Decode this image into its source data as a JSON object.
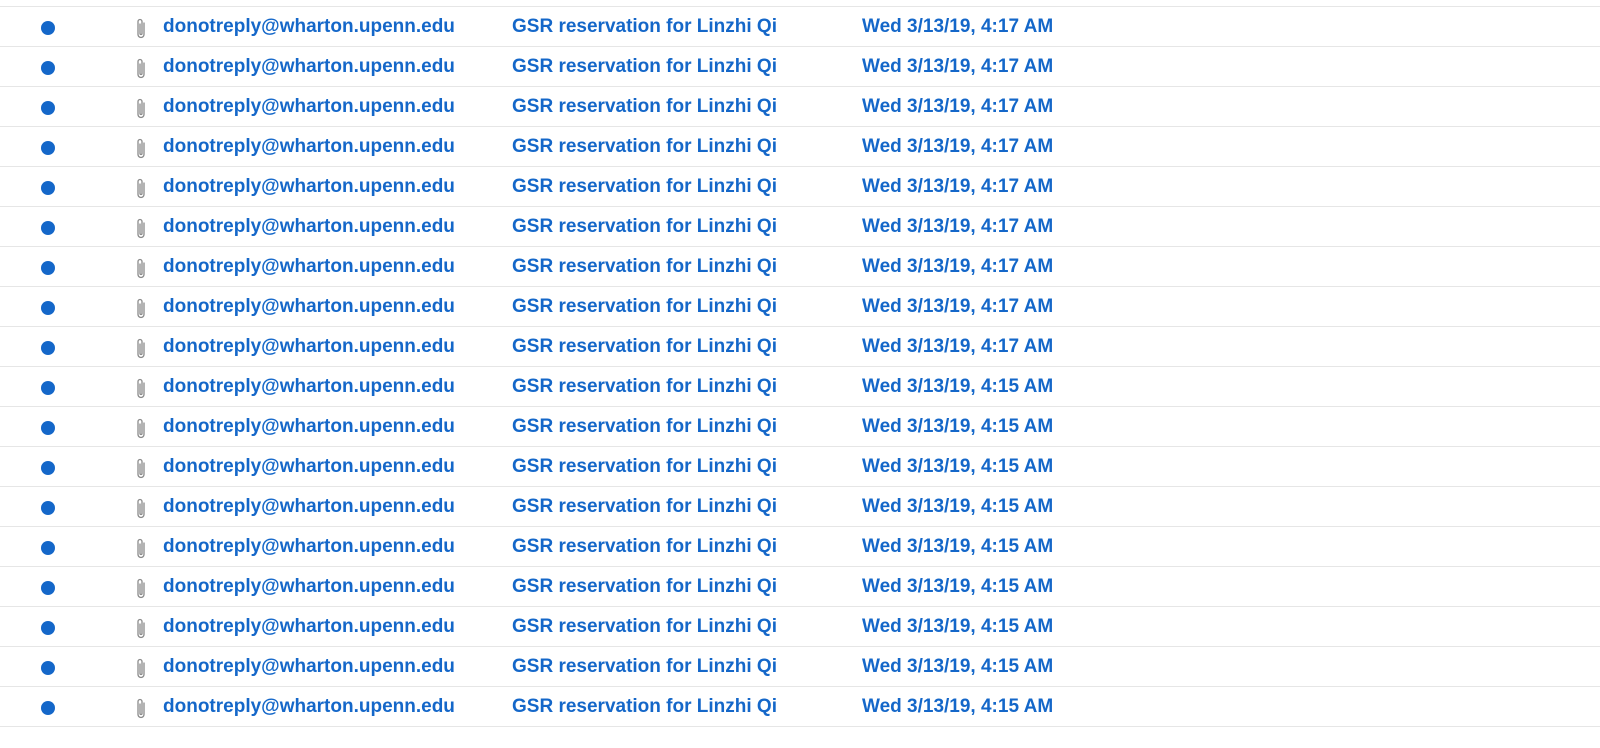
{
  "colors": {
    "unread_accent": "#1467c9",
    "row_divider": "#e6e6e6",
    "attachment_icon": "#8a8a8a"
  },
  "icons": {
    "unread": "unread-dot-icon",
    "attachment": "paperclip-icon"
  },
  "messages": [
    {
      "sender": "donotreply@wharton.upenn.edu",
      "subject": "GSR reservation for Linzhi Qi",
      "date": "Wed 3/13/19, 4:17 AM",
      "unread": true,
      "has_attachment": true
    },
    {
      "sender": "donotreply@wharton.upenn.edu",
      "subject": "GSR reservation for Linzhi Qi",
      "date": "Wed 3/13/19, 4:17 AM",
      "unread": true,
      "has_attachment": true
    },
    {
      "sender": "donotreply@wharton.upenn.edu",
      "subject": "GSR reservation for Linzhi Qi",
      "date": "Wed 3/13/19, 4:17 AM",
      "unread": true,
      "has_attachment": true
    },
    {
      "sender": "donotreply@wharton.upenn.edu",
      "subject": "GSR reservation for Linzhi Qi",
      "date": "Wed 3/13/19, 4:17 AM",
      "unread": true,
      "has_attachment": true
    },
    {
      "sender": "donotreply@wharton.upenn.edu",
      "subject": "GSR reservation for Linzhi Qi",
      "date": "Wed 3/13/19, 4:17 AM",
      "unread": true,
      "has_attachment": true
    },
    {
      "sender": "donotreply@wharton.upenn.edu",
      "subject": "GSR reservation for Linzhi Qi",
      "date": "Wed 3/13/19, 4:17 AM",
      "unread": true,
      "has_attachment": true
    },
    {
      "sender": "donotreply@wharton.upenn.edu",
      "subject": "GSR reservation for Linzhi Qi",
      "date": "Wed 3/13/19, 4:17 AM",
      "unread": true,
      "has_attachment": true
    },
    {
      "sender": "donotreply@wharton.upenn.edu",
      "subject": "GSR reservation for Linzhi Qi",
      "date": "Wed 3/13/19, 4:17 AM",
      "unread": true,
      "has_attachment": true
    },
    {
      "sender": "donotreply@wharton.upenn.edu",
      "subject": "GSR reservation for Linzhi Qi",
      "date": "Wed 3/13/19, 4:17 AM",
      "unread": true,
      "has_attachment": true
    },
    {
      "sender": "donotreply@wharton.upenn.edu",
      "subject": "GSR reservation for Linzhi Qi",
      "date": "Wed 3/13/19, 4:15 AM",
      "unread": true,
      "has_attachment": true
    },
    {
      "sender": "donotreply@wharton.upenn.edu",
      "subject": "GSR reservation for Linzhi Qi",
      "date": "Wed 3/13/19, 4:15 AM",
      "unread": true,
      "has_attachment": true
    },
    {
      "sender": "donotreply@wharton.upenn.edu",
      "subject": "GSR reservation for Linzhi Qi",
      "date": "Wed 3/13/19, 4:15 AM",
      "unread": true,
      "has_attachment": true
    },
    {
      "sender": "donotreply@wharton.upenn.edu",
      "subject": "GSR reservation for Linzhi Qi",
      "date": "Wed 3/13/19, 4:15 AM",
      "unread": true,
      "has_attachment": true
    },
    {
      "sender": "donotreply@wharton.upenn.edu",
      "subject": "GSR reservation for Linzhi Qi",
      "date": "Wed 3/13/19, 4:15 AM",
      "unread": true,
      "has_attachment": true
    },
    {
      "sender": "donotreply@wharton.upenn.edu",
      "subject": "GSR reservation for Linzhi Qi",
      "date": "Wed 3/13/19, 4:15 AM",
      "unread": true,
      "has_attachment": true
    },
    {
      "sender": "donotreply@wharton.upenn.edu",
      "subject": "GSR reservation for Linzhi Qi",
      "date": "Wed 3/13/19, 4:15 AM",
      "unread": true,
      "has_attachment": true
    },
    {
      "sender": "donotreply@wharton.upenn.edu",
      "subject": "GSR reservation for Linzhi Qi",
      "date": "Wed 3/13/19, 4:15 AM",
      "unread": true,
      "has_attachment": true
    },
    {
      "sender": "donotreply@wharton.upenn.edu",
      "subject": "GSR reservation for Linzhi Qi",
      "date": "Wed 3/13/19, 4:15 AM",
      "unread": true,
      "has_attachment": true
    }
  ]
}
